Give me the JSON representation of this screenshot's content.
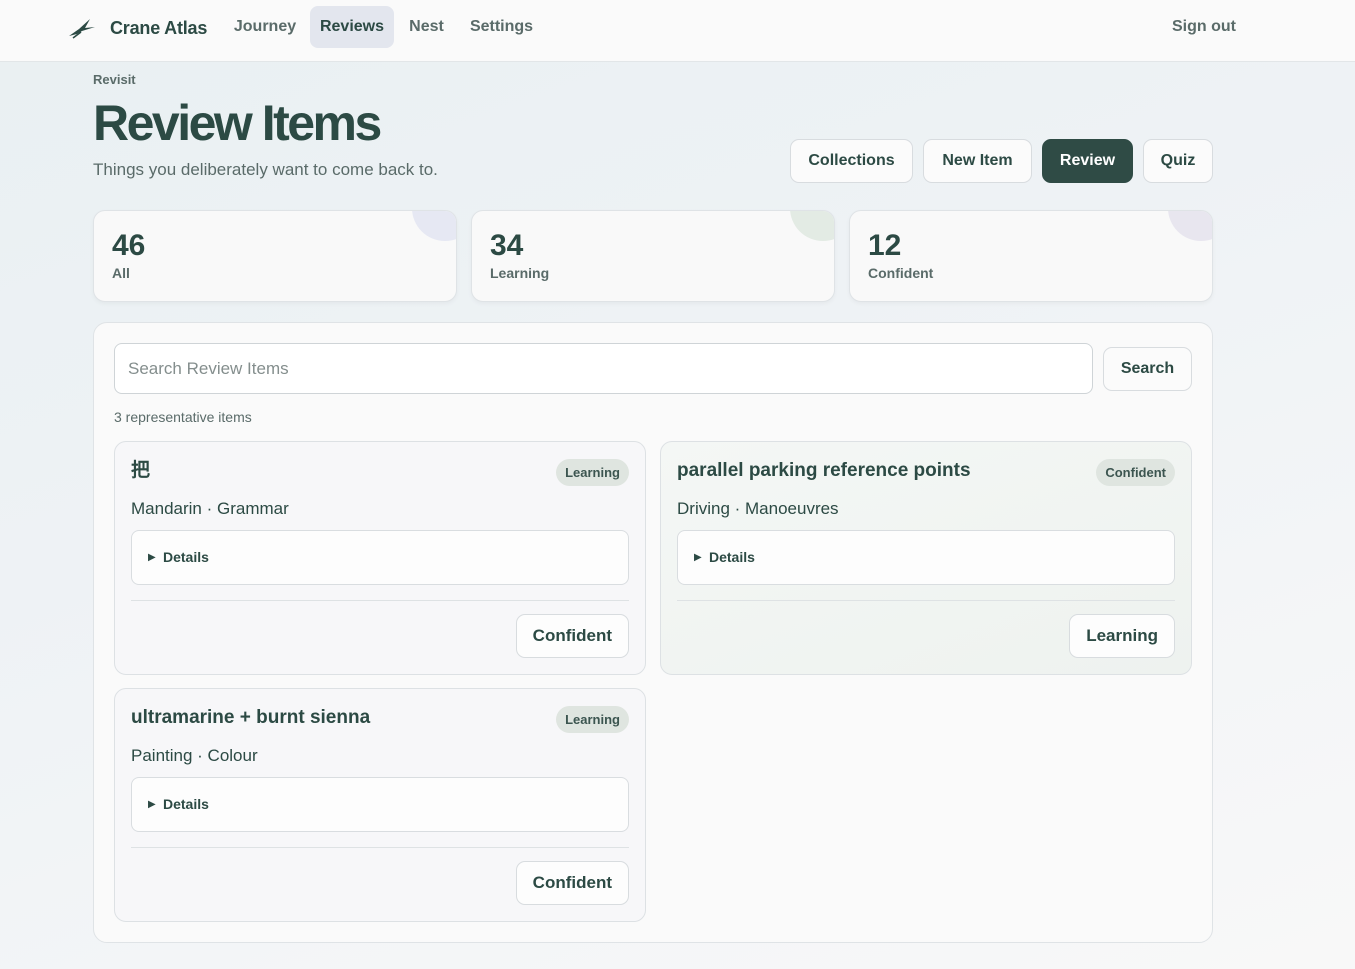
{
  "app": {
    "name": "Crane Atlas"
  },
  "nav": {
    "items": [
      {
        "label": "Journey"
      },
      {
        "label": "Reviews",
        "active": true
      },
      {
        "label": "Nest"
      },
      {
        "label": "Settings"
      }
    ],
    "signout_label": "Sign out"
  },
  "header": {
    "eyebrow": "Revisit",
    "title": "Review Items",
    "subtitle": "Things you deliberately want to come back to."
  },
  "actions": {
    "collections": "Collections",
    "new_item": "New Item",
    "review": "Review",
    "quiz": "Quiz"
  },
  "stats": [
    {
      "value": "46",
      "label": "All",
      "accent": "#e6e8f3"
    },
    {
      "value": "34",
      "label": "Learning",
      "accent": "#e3ebe4"
    },
    {
      "value": "12",
      "label": "Confident",
      "accent": "#e8e6ef"
    }
  ],
  "search": {
    "placeholder": "Search Review Items",
    "value": "",
    "button_label": "Search"
  },
  "results_count_text": "3 representative items",
  "items": [
    {
      "title": "把",
      "status": "Learning",
      "meta": "Mandarin · Grammar",
      "details_label": "Details",
      "action_label": "Confident"
    },
    {
      "title": "parallel parking reference points",
      "status": "Confident",
      "meta": "Driving · Manoeuvres",
      "details_label": "Details",
      "action_label": "Learning"
    },
    {
      "title": "ultramarine + burnt sienna",
      "status": "Learning",
      "meta": "Painting · Colour",
      "details_label": "Details",
      "action_label": "Confident"
    }
  ],
  "colors": {
    "primary": "#2f4b45",
    "text": "#2c4a44",
    "muted": "#5a6b69",
    "badge_bg": "#dfe5e0"
  },
  "icons": {
    "logo": "crane-logo-icon",
    "disclosure": "triangle-right-icon"
  }
}
